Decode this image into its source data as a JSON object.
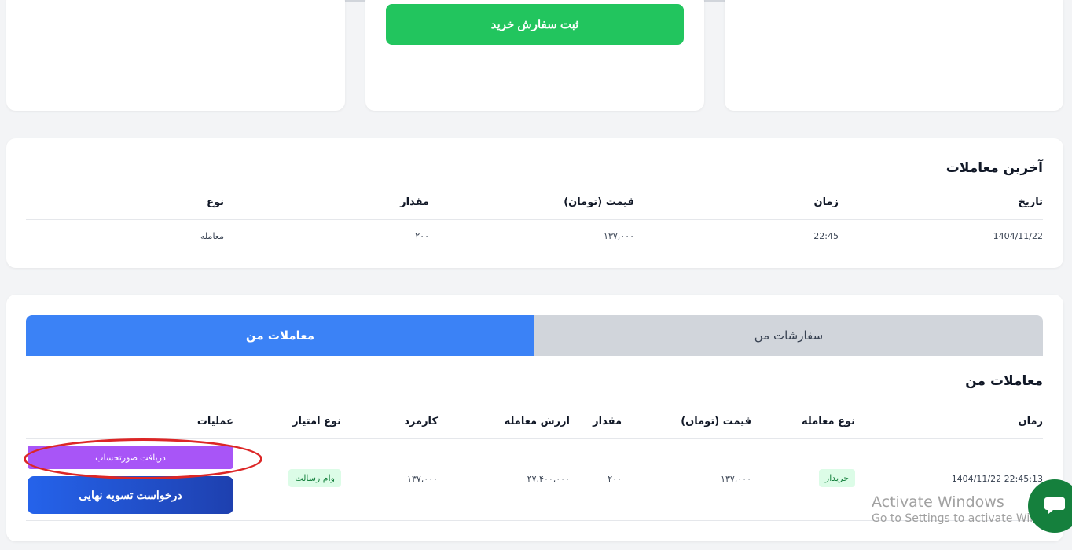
{
  "top": {
    "buy_button": "ثبت سفارش خرید"
  },
  "recent": {
    "title": "آخرین معاملات",
    "headers": {
      "date": "تاریخ",
      "time": "زمان",
      "price": "قیمت (تومان)",
      "amount": "مقدار",
      "type": "نوع"
    },
    "row": {
      "date": "1404/11/22",
      "time": "22:45",
      "price": "۱۳۷,۰۰۰",
      "amount": "۲۰۰",
      "type": "معامله"
    }
  },
  "my": {
    "tabs": {
      "my_trades": "معاملات من",
      "my_orders": "سفارشات من"
    },
    "title": "معاملات من",
    "headers": {
      "time": "زمان",
      "trade_type": "نوع معامله",
      "price": "قیمت (تومان)",
      "amount": "مقدار",
      "value": "ارزش معامله",
      "fee": "کارمزد",
      "privilege": "نوع امتیاز",
      "operations": "عملیات"
    },
    "row": {
      "time": "22:45:13 1404/11/22",
      "trade_type": "خریدار",
      "price": "۱۳۷,۰۰۰",
      "amount": "۲۰۰",
      "value": "۲۷,۴۰۰,۰۰۰",
      "fee": "۱۳۷,۰۰۰",
      "privilege": "وام رسالت",
      "invoice_button": "دریافت صورتحساب",
      "settle_button": "درخواست تسویه نهایی"
    }
  },
  "watermark": {
    "line1": "Activate Windows",
    "line2": "Go to Settings to activate Windows."
  },
  "colors": {
    "primary": "#3b82f6",
    "success": "#22c55e",
    "purple": "#a855f7",
    "highlight": "#dc2626"
  },
  "icons": {
    "chat": "chat-bubble-icon"
  }
}
